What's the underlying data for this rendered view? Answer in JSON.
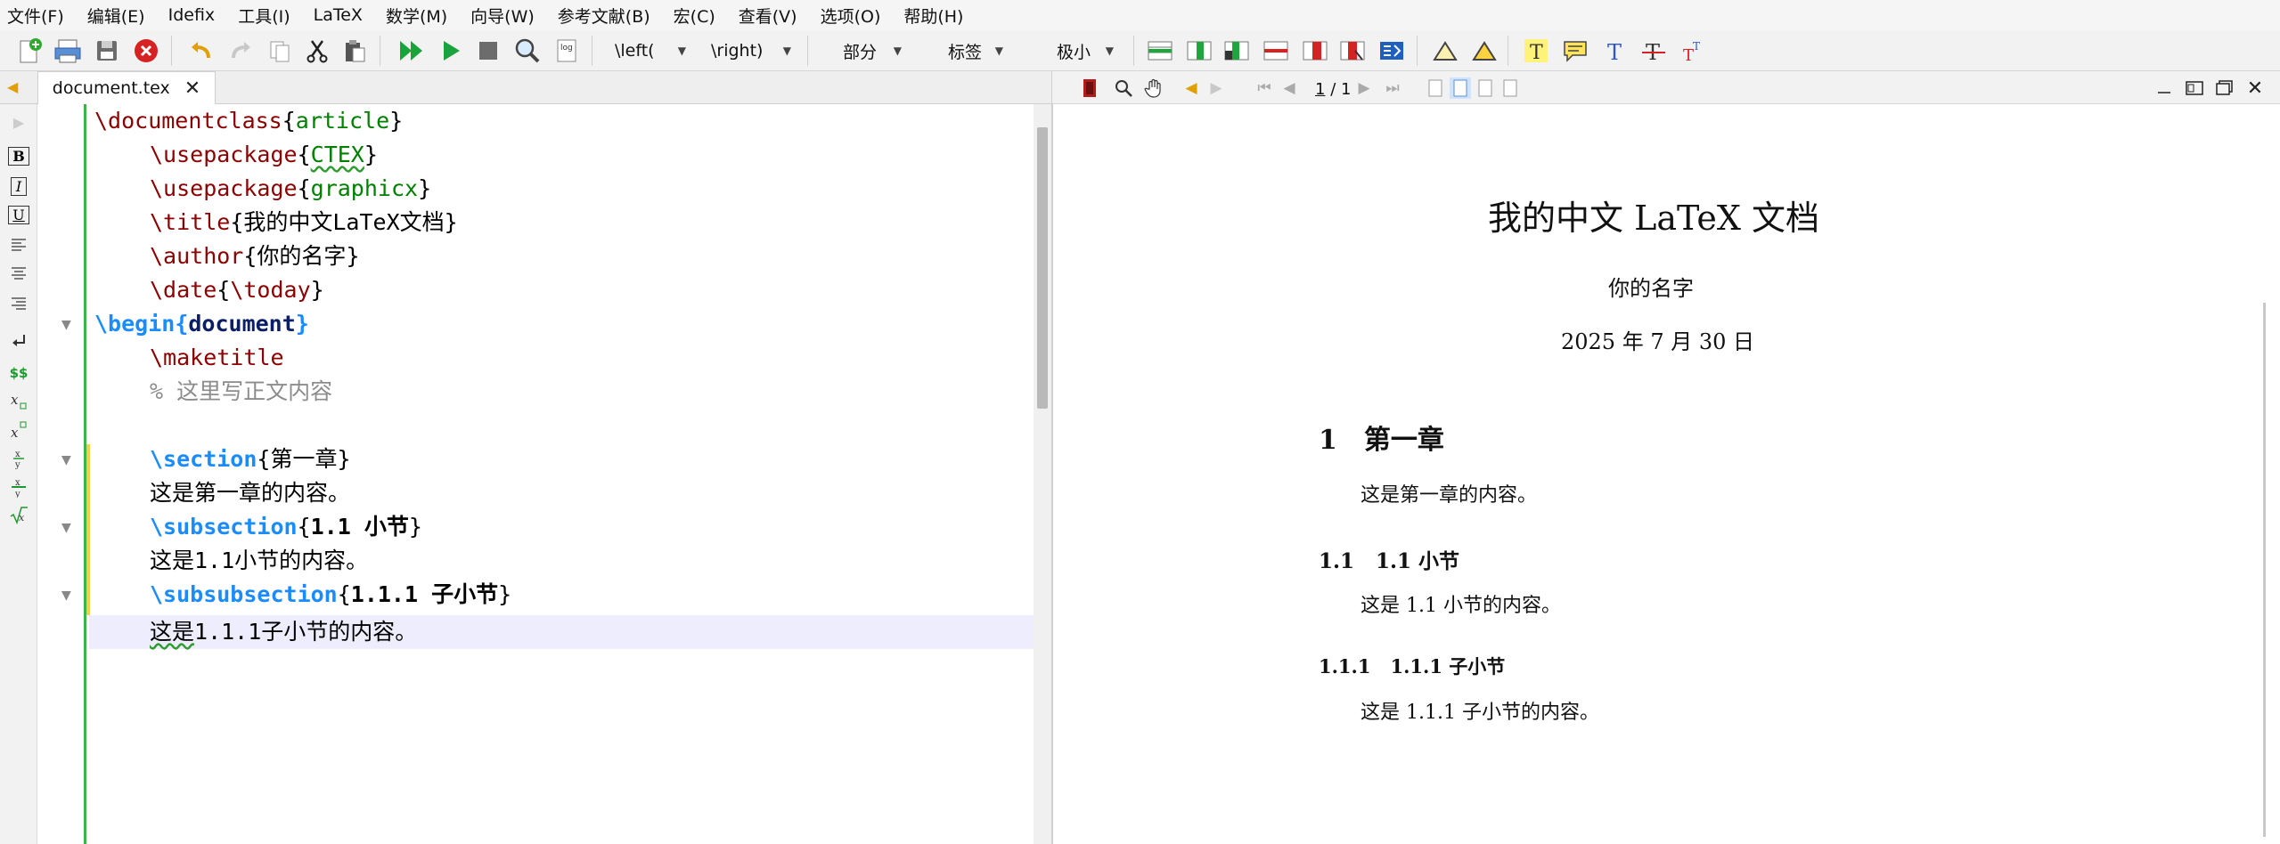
{
  "menubar": [
    "文件(F)",
    "编辑(E)",
    "Idefix",
    "工具(I)",
    "LaTeX",
    "数学(M)",
    "向导(W)",
    "参考文献(B)",
    "宏(C)",
    "查看(V)",
    "选项(O)",
    "帮助(H)"
  ],
  "toolbar": {
    "left_dd": "\\left(",
    "right_dd": "\\right)",
    "part_dd": "部分",
    "label_dd": "标签",
    "size_dd": "极小"
  },
  "tab": {
    "label": "document.tex"
  },
  "sidepanel": {
    "math_inline": "$$"
  },
  "viewer": {
    "page_current": "1",
    "page_sep": "/",
    "page_total": "1"
  },
  "code": {
    "l1": {
      "cmd": "\\documentclass",
      "open": "{",
      "arg": "article",
      "close": "}"
    },
    "l2": {
      "cmd": "\\usepackage",
      "open": "{",
      "arg": "CTEX",
      "close": "}"
    },
    "l3": {
      "cmd": "\\usepackage",
      "open": "{",
      "arg": "graphicx",
      "close": "}"
    },
    "l4": {
      "cmd": "\\title",
      "open": "{",
      "arg": "我的中文LaTeX文档",
      "close": "}"
    },
    "l5": {
      "cmd": "\\author",
      "open": "{",
      "arg": "你的名字",
      "close": "}"
    },
    "l6": {
      "cmd": "\\date",
      "open": "{",
      "arg": "\\today",
      "close": "}"
    },
    "l7": {
      "cmd": "\\begin",
      "open": "{",
      "arg": "document",
      "close": "}"
    },
    "l8": {
      "cmd": "\\maketitle"
    },
    "l9": {
      "text": "% 这里写正文内容"
    },
    "l11": {
      "cmd": "\\section",
      "open": "{",
      "arg": "第一章",
      "close": "}"
    },
    "l12": {
      "text": "这是第一章的内容。"
    },
    "l13": {
      "cmd": "\\subsection",
      "open": "{",
      "arg": "1.1 小节",
      "close": "}"
    },
    "l14": {
      "text": "这是1.1小节的内容。"
    },
    "l15": {
      "cmd": "\\subsubsection",
      "open": "{",
      "arg": "1.1.1 子小节",
      "close": "}"
    },
    "l16": {
      "text_a": "这是",
      "text_b": "1.1.1子小节的内容。"
    }
  },
  "pdf": {
    "title": "我的中文 LaTeX 文档",
    "author": "你的名字",
    "date": "2025 年 7 月 30 日",
    "s1_num": "1",
    "s1_title": "第一章",
    "s1_body": "这是第一章的内容。",
    "ss_num": "1.1",
    "ss_title": "1.1 小节",
    "ss_body": "这是 1.1 小节的内容。",
    "sss_num": "1.1.1",
    "sss_title": "1.1.1 子小节",
    "sss_body": "这是 1.1.1 子小节的内容。"
  }
}
